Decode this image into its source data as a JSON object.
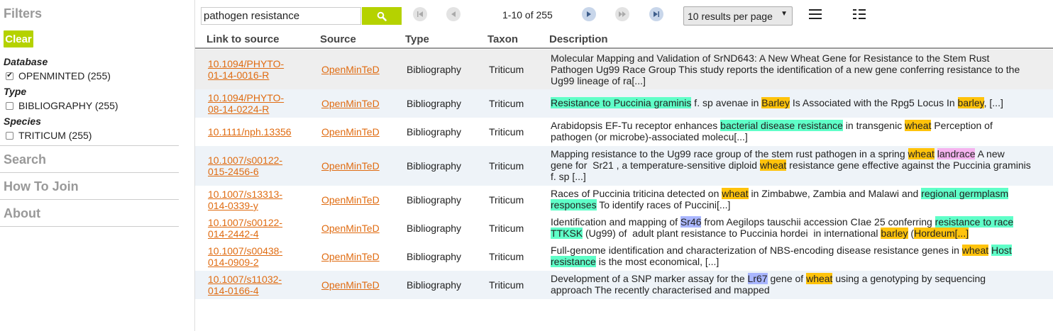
{
  "sidebar": {
    "title": "Filters",
    "clear_label": "Clear",
    "groups": [
      {
        "label": "Database",
        "facets": [
          {
            "label": "OPENMINTED (255)",
            "checked": true
          }
        ]
      },
      {
        "label": "Type",
        "facets": [
          {
            "label": "BIBLIOGRAPHY (255)",
            "checked": false
          }
        ]
      },
      {
        "label": "Species",
        "facets": [
          {
            "label": "TRITICUM (255)",
            "checked": false
          }
        ]
      }
    ],
    "sections": [
      "Search",
      "How To Join",
      "About"
    ]
  },
  "toolbar": {
    "search_value": "pathogen resistance",
    "page_info": "1-10 of 255",
    "per_page": "10 results per page",
    "icons": [
      "search-icon",
      "first-page-icon",
      "prev-page-icon",
      "next-page-icon",
      "fast-forward-icon",
      "last-page-icon",
      "list-view-icon",
      "grid-view-icon"
    ]
  },
  "table": {
    "headers": [
      "Link to source",
      "Source",
      "Type",
      "Taxon",
      "Description"
    ],
    "rows": [
      {
        "link": [
          "10.1094/PHYTO-",
          "01-14-0016-R"
        ],
        "source": "OpenMinTeD",
        "type": "Bibliography",
        "taxon": "Triticum",
        "desc": [
          [
            [
              "Molecular Mapping and Validation of SrND643: A New Wheat Gene for Resistance to the Stem Rust",
              ""
            ]
          ],
          [
            [
              "Pathogen Ug99 Race Group This study reports the identification of a new gene conferring resistance to the",
              ""
            ]
          ],
          [
            [
              "Ug99 lineage of ra[...]",
              ""
            ]
          ]
        ]
      },
      {
        "link": [
          "10.1094/PHYTO-",
          "08-14-0224-R"
        ],
        "source": "OpenMinTeD",
        "type": "Bibliography",
        "taxon": "Triticum",
        "desc": [
          [
            [
              "Resistance to Puccinia graminis",
              "cyan"
            ],
            [
              " f. sp avenae in ",
              ""
            ],
            [
              "Barley",
              "org"
            ],
            [
              " Is Associated with the Rpg5 Locus In ",
              ""
            ],
            [
              "barley",
              "org"
            ],
            [
              ", [...]",
              ""
            ]
          ]
        ]
      },
      {
        "link": [
          "10.1111/nph.13356"
        ],
        "source": "OpenMinTeD",
        "type": "Bibliography",
        "taxon": "Triticum",
        "desc": [
          [
            [
              "Arabidopsis EF-Tu receptor enhances ",
              ""
            ],
            [
              "bacterial disease resistance",
              "cyan"
            ],
            [
              " in transgenic ",
              ""
            ],
            [
              "wheat",
              "org"
            ],
            [
              " Perception of",
              ""
            ]
          ],
          [
            [
              "pathogen (or microbe)-associated molecu[...]",
              ""
            ]
          ]
        ]
      },
      {
        "link": [
          "10.1007/s00122-",
          "015-2456-6"
        ],
        "source": "OpenMinTeD",
        "type": "Bibliography",
        "taxon": "Triticum",
        "desc": [
          [
            [
              "Mapping resistance to the Ug99 race group of the stem rust pathogen in a spring ",
              ""
            ],
            [
              "wheat",
              "org"
            ],
            [
              " ",
              ""
            ],
            [
              "landrace",
              "pink"
            ],
            [
              " A new",
              ""
            ]
          ],
          [
            [
              "gene for  Sr21 , a temperature-sensitive diploid ",
              ""
            ],
            [
              "wheat",
              "org"
            ],
            [
              " resistance gene effective against the Puccinia graminis",
              ""
            ]
          ],
          [
            [
              "f. sp [...]",
              ""
            ]
          ]
        ]
      },
      {
        "link": [
          "10.1007/s13313-",
          "014-0339-y"
        ],
        "source": "OpenMinTeD",
        "type": "Bibliography",
        "taxon": "Triticum",
        "desc": [
          [
            [
              "Races of Puccinia triticina detected on ",
              ""
            ],
            [
              "wheat",
              "org"
            ],
            [
              " in Zimbabwe, Zambia and Malawi and ",
              ""
            ],
            [
              "regional germplasm",
              "cyan"
            ]
          ],
          [
            [
              "responses",
              "cyan"
            ],
            [
              " To identify races of Puccini[...]",
              ""
            ]
          ]
        ]
      },
      {
        "link": [
          "10.1007/s00122-",
          "014-2442-4"
        ],
        "source": "OpenMinTeD",
        "type": "Bibliography",
        "taxon": "Triticum",
        "desc": [
          [
            [
              "Identification and mapping of ",
              ""
            ],
            [
              "Sr46",
              "blue"
            ],
            [
              " from Aegilops tauschii accession CIae 25 conferring ",
              ""
            ],
            [
              "resistance to race",
              "cyan"
            ]
          ],
          [
            [
              "TTKSK",
              "cyan"
            ],
            [
              " (Ug99) of  adult plant resistance to Puccinia hordei  in international ",
              ""
            ],
            [
              "barley",
              "org"
            ],
            [
              " (",
              ""
            ],
            [
              "Hordeum[...]",
              "org"
            ]
          ]
        ]
      },
      {
        "link": [
          "10.1007/s00438-",
          "014-0909-2"
        ],
        "source": "OpenMinTeD",
        "type": "Bibliography",
        "taxon": "Triticum",
        "desc": [
          [
            [
              "Full-genome identification and characterization of NBS-encoding disease resistance genes in ",
              ""
            ],
            [
              "wheat",
              "org"
            ],
            [
              " ",
              ""
            ],
            [
              "Host",
              "cyan"
            ]
          ],
          [
            [
              "resistance",
              "cyan"
            ],
            [
              " is the most economical, [...]",
              ""
            ]
          ]
        ]
      },
      {
        "link": [
          "10.1007/s11032-",
          "014-0166-4"
        ],
        "source": "OpenMinTeD",
        "type": "Bibliography",
        "taxon": "Triticum",
        "desc": [
          [
            [
              "Development of a SNP marker assay for the ",
              ""
            ],
            [
              "Lr67",
              "blue"
            ],
            [
              " gene of ",
              ""
            ],
            [
              "wheat",
              "org"
            ],
            [
              " using a genotyping by sequencing",
              ""
            ]
          ],
          [
            [
              "approach The recently characterised and mapped",
              ""
            ]
          ]
        ]
      }
    ]
  },
  "colors": {
    "accent": "#b5d200",
    "link": "#e06c12",
    "highlight_orange": "#ffc30b",
    "highlight_cyan": "#5fffc8",
    "highlight_blue": "#a9b6ff",
    "highlight_pink": "#f5b3ef"
  }
}
